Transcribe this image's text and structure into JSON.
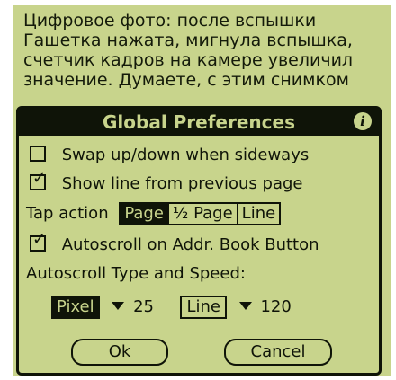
{
  "background_text": "Цифровое фото: после вспышки\nГашетка нажата, мигнула вспышка,\nсчетчик кадров на камере увеличил\nзначение. Думаете, с этим снимком",
  "dialog": {
    "title": "Global Preferences",
    "info_icon": "info-icon",
    "swap_label": "Swap up/down when sideways",
    "swap_checked": false,
    "show_line_label": "Show line from previous page",
    "show_line_checked": true,
    "tap_action_label": "Tap action",
    "tap_options": [
      "Page",
      "½ Page",
      "Line"
    ],
    "tap_selected": "Page",
    "autoscroll_label": "Autoscroll on Addr. Book Button",
    "autoscroll_checked": true,
    "autoscroll_type_label": "Autoscroll Type and Speed:",
    "type1_value": "Pixel",
    "speed1_value": "25",
    "type2_value": "Line",
    "speed2_value": "120",
    "ok_label": "Ok",
    "cancel_label": "Cancel"
  },
  "colors": {
    "lcd": "#c8d48c",
    "ink": "#0f1408"
  }
}
